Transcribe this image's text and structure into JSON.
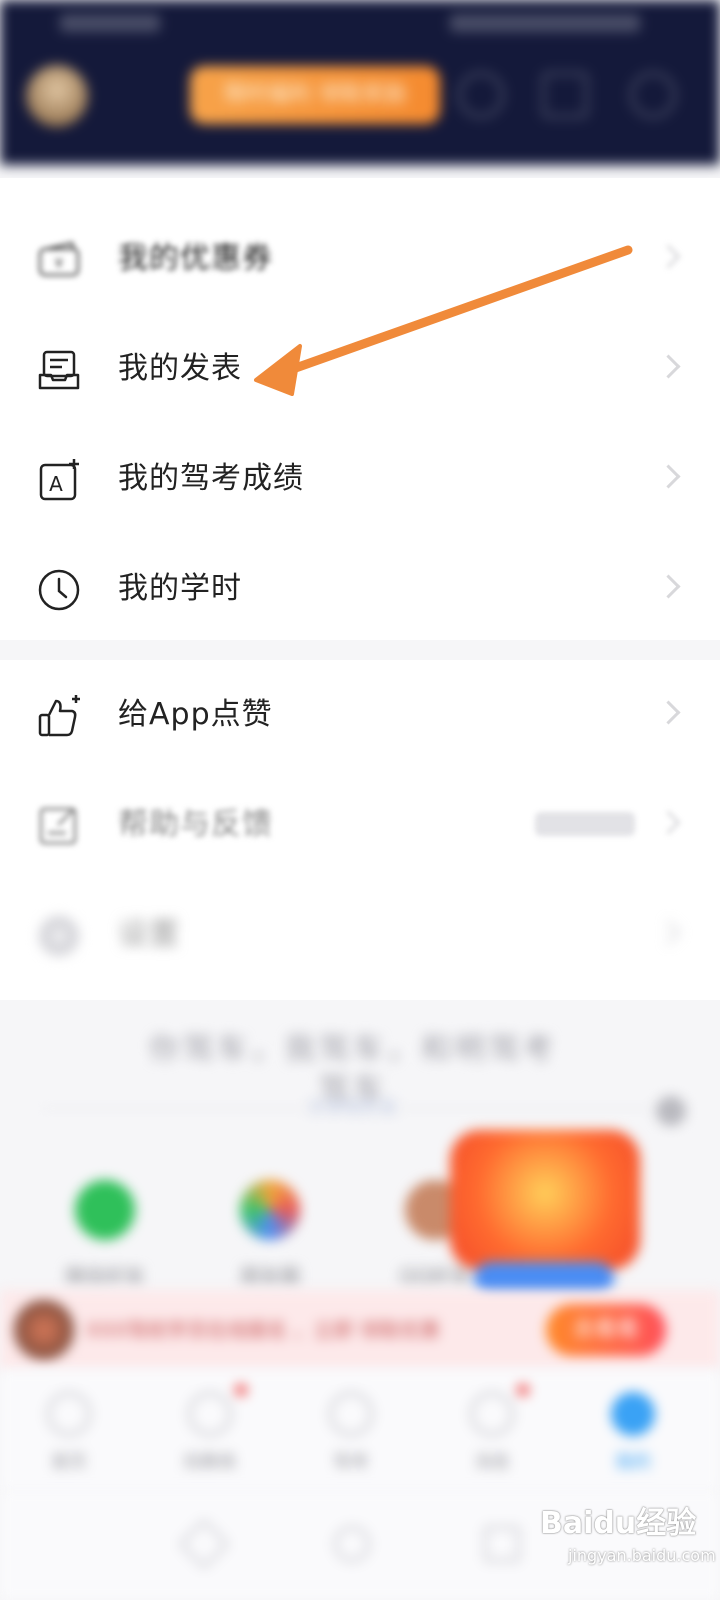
{
  "header": {
    "promo_label": "限时福利 领取奖励"
  },
  "menu_group1": [
    {
      "label": "我的优惠券",
      "icon": "coupon-icon"
    },
    {
      "label": "我的发表",
      "icon": "inbox-tray-icon"
    },
    {
      "label": "我的驾考成绩",
      "icon": "score-card-icon"
    },
    {
      "label": "我的学时",
      "icon": "clock-icon"
    }
  ],
  "menu_group2": [
    {
      "label": "给App点赞",
      "icon": "thumbs-up-icon"
    },
    {
      "label": "帮助与反馈",
      "icon": "edit-feedback-icon"
    },
    {
      "label": "设置",
      "icon": "gear-icon"
    }
  ],
  "footer": {
    "slogan": "你驾车，我驾车，和明驾考驾车",
    "sublink": "分享给好友"
  },
  "share": [
    {
      "label": "微信好友",
      "color": "#2fc05a"
    },
    {
      "label": "朋友圈",
      "color": "#f2a63a"
    },
    {
      "label": "QQ好友",
      "color": "#c98a6a"
    }
  ],
  "notice": {
    "text": "XXX驾校学员在线报名 ，立即 领取优惠",
    "button": "去看看"
  },
  "tabs": [
    {
      "label": "首页",
      "dot": false
    },
    {
      "label": "找教练",
      "dot": true
    },
    {
      "label": "驾考",
      "dot": false
    },
    {
      "label": "消息",
      "dot": true
    },
    {
      "label": "我的",
      "dot": false,
      "active": true
    }
  ],
  "watermark": {
    "brand": "Baidu经验",
    "url": "jingyan.baidu.com"
  },
  "annotation_color": "#f08a3a"
}
